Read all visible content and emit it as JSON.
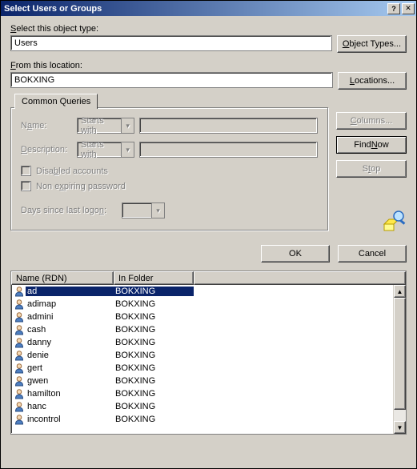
{
  "title": "Select Users or Groups",
  "object_type_label": "Select this object type:",
  "object_type_value": "Users",
  "object_types_btn": "Object Types...",
  "location_label": "From this location:",
  "location_value": "BOKXING",
  "locations_btn": "Locations...",
  "common_queries_tab": "Common Queries",
  "name_label": "Name:",
  "desc_label": "Description:",
  "starts_with": "Starts with",
  "disabled_accounts": "Disabled accounts",
  "non_expiring": "Non expiring password",
  "days_since": "Days since last logon:",
  "columns_btn": "Columns...",
  "find_now_btn": "Find Now",
  "stop_btn": "Stop",
  "ok_btn": "OK",
  "cancel_btn": "Cancel",
  "col_name": "Name (RDN)",
  "col_folder": "In Folder",
  "results": [
    {
      "name": "ad",
      "folder": "BOKXING",
      "selected": true
    },
    {
      "name": "adimap",
      "folder": "BOKXING"
    },
    {
      "name": "admini",
      "folder": "BOKXING"
    },
    {
      "name": "cash",
      "folder": "BOKXING"
    },
    {
      "name": "danny",
      "folder": "BOKXING"
    },
    {
      "name": "denie",
      "folder": "BOKXING"
    },
    {
      "name": "gert",
      "folder": "BOKXING"
    },
    {
      "name": "gwen",
      "folder": "BOKXING"
    },
    {
      "name": "hamilton",
      "folder": "BOKXING"
    },
    {
      "name": "hanc",
      "folder": "BOKXING"
    },
    {
      "name": "incontrol",
      "folder": "BOKXING"
    }
  ]
}
